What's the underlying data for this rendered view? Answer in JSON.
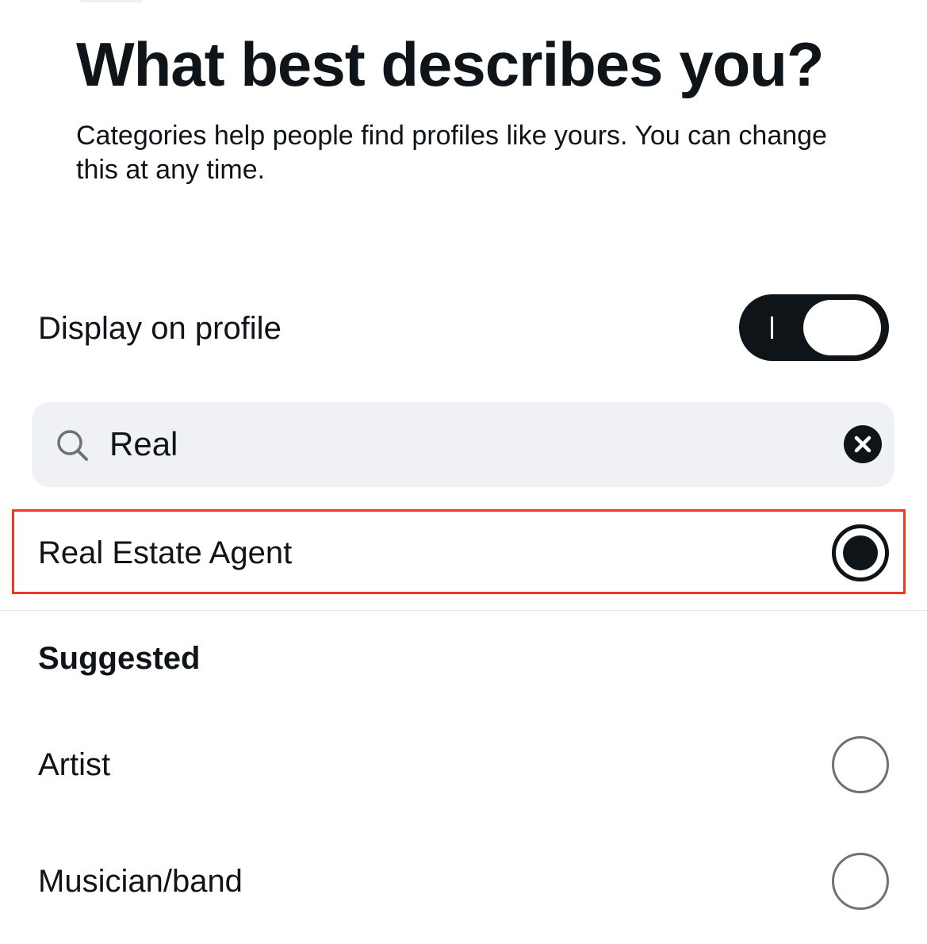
{
  "header": {
    "title": "What best describes you?",
    "subtitle": "Categories help people find profiles like yours. You can change this at any time."
  },
  "display_toggle": {
    "label": "Display on profile",
    "on": true
  },
  "search": {
    "value": "Real",
    "icon": "search-icon",
    "clear_icon": "close-icon"
  },
  "results": [
    {
      "label": "Real Estate Agent",
      "selected": true,
      "highlighted": true
    }
  ],
  "suggested": {
    "heading": "Suggested",
    "items": [
      {
        "label": "Artist",
        "selected": false
      },
      {
        "label": "Musician/band",
        "selected": false
      }
    ]
  },
  "colors": {
    "text": "#0f1419",
    "highlight_border": "#ee3a23",
    "search_background": "#eff1f4",
    "radio_unselected_border": "#6b7278"
  }
}
